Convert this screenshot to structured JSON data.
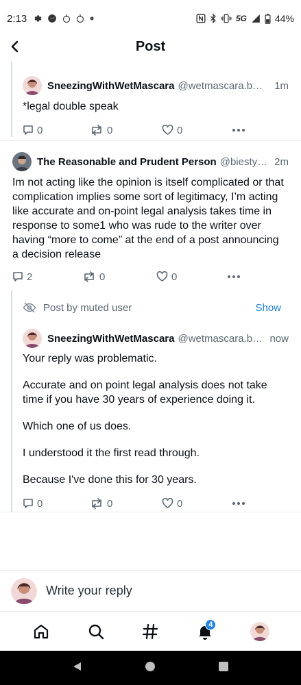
{
  "status_bar": {
    "time": "2:13",
    "network": "5G",
    "battery": "44%",
    "icons": [
      "gear-icon",
      "messenger-icon",
      "notification-icon",
      "notification-icon",
      "dot-icon",
      "nfc-icon",
      "bluetooth-icon",
      "vibrate-icon",
      "signal-icon",
      "battery-icon"
    ]
  },
  "header": {
    "title": "Post"
  },
  "posts": [
    {
      "author": "SneezingWithWetMascara",
      "handle": "@wetmascara.b…",
      "time": "1m",
      "text": [
        "*legal double speak"
      ],
      "replies": "0",
      "reposts": "0",
      "likes": "0"
    },
    {
      "author": "The Reasonable and Prudent Person",
      "handle": "@biesty…",
      "time": "2m",
      "text": [
        "Im not acting like the opinion is itself complicated or that complication implies some sort of legitimacy, I’m acting like accurate and on-point legal analysis takes time in response to some1 who was rude to the writer over having “more to come” at the end of a post announcing a decision release"
      ],
      "replies": "2",
      "reposts": "0",
      "likes": "0"
    },
    {
      "muted_label": "Post by muted user",
      "show_label": "Show",
      "author": "SneezingWithWetMascara",
      "handle": "@wetmascara.b…",
      "time": "now",
      "text": [
        "Your reply was problematic.",
        "Accurate and on point legal analysis does not take time if you have 30 years of experience doing it.",
        "Which one of us does.",
        "I understood it the first read through.",
        "Because I've done this for 30 years."
      ],
      "replies": "0",
      "reposts": "0",
      "likes": "0"
    }
  ],
  "reply_box": {
    "placeholder": "Write your reply"
  },
  "tabs": [
    {
      "name": "home-icon"
    },
    {
      "name": "search-icon"
    },
    {
      "name": "hashtag-icon"
    },
    {
      "name": "notifications-icon",
      "badge": "4"
    },
    {
      "name": "profile-avatar"
    }
  ],
  "colors": {
    "accent": "#1a7fe6",
    "badge": "#1d85ec",
    "muted_text": "#5b6774",
    "divider": "#e4e8ee"
  }
}
